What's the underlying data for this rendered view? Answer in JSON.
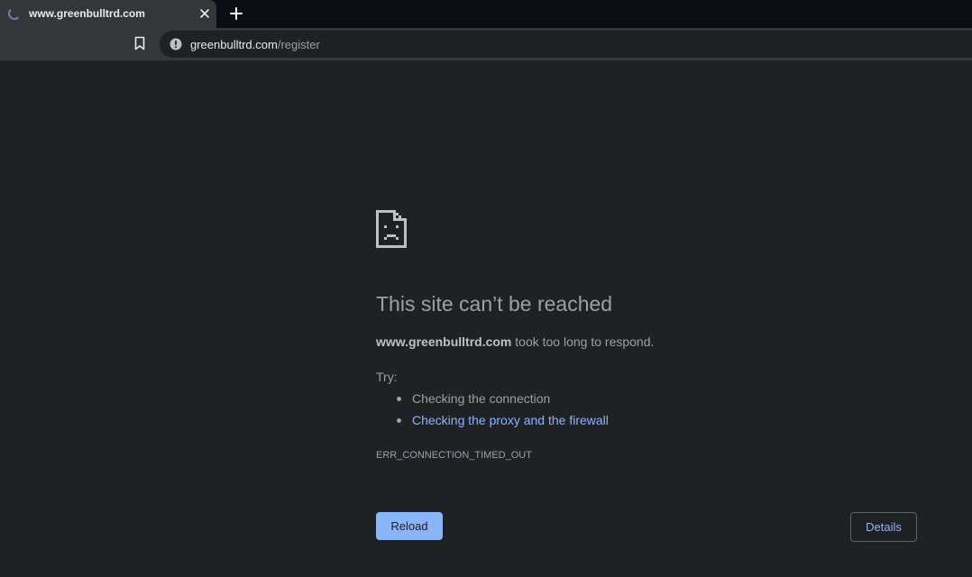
{
  "tab": {
    "title": "www.greenbulltrd.com",
    "loading_icon": "spinner-icon",
    "close_icon": "close-icon"
  },
  "toolbar": {
    "new_tab_icon": "plus-icon",
    "bookmark_icon": "bookmark-icon",
    "site_info_icon": "info-icon",
    "url_host": "greenbulltrd.com",
    "url_path": "/register"
  },
  "error": {
    "icon": "sad-document-icon",
    "headline": "This site can’t be reached",
    "summary_host": "www.greenbulltrd.com",
    "summary_rest": " took too long to respond.",
    "try_label": "Try:",
    "suggestions": [
      {
        "text": "Checking the connection",
        "is_link": false
      },
      {
        "text": "Checking the proxy and the firewall",
        "is_link": true
      }
    ],
    "code": "ERR_CONNECTION_TIMED_OUT",
    "reload_label": "Reload",
    "details_label": "Details"
  },
  "colors": {
    "page_background": "#202124",
    "chrome_background": "#35363a",
    "tabstrip_background": "#0b0c14",
    "text_secondary": "#9aa0a6",
    "text_primary": "#e8eaed",
    "accent_blue": "#8ab4f8",
    "button_border": "#5f6368"
  }
}
